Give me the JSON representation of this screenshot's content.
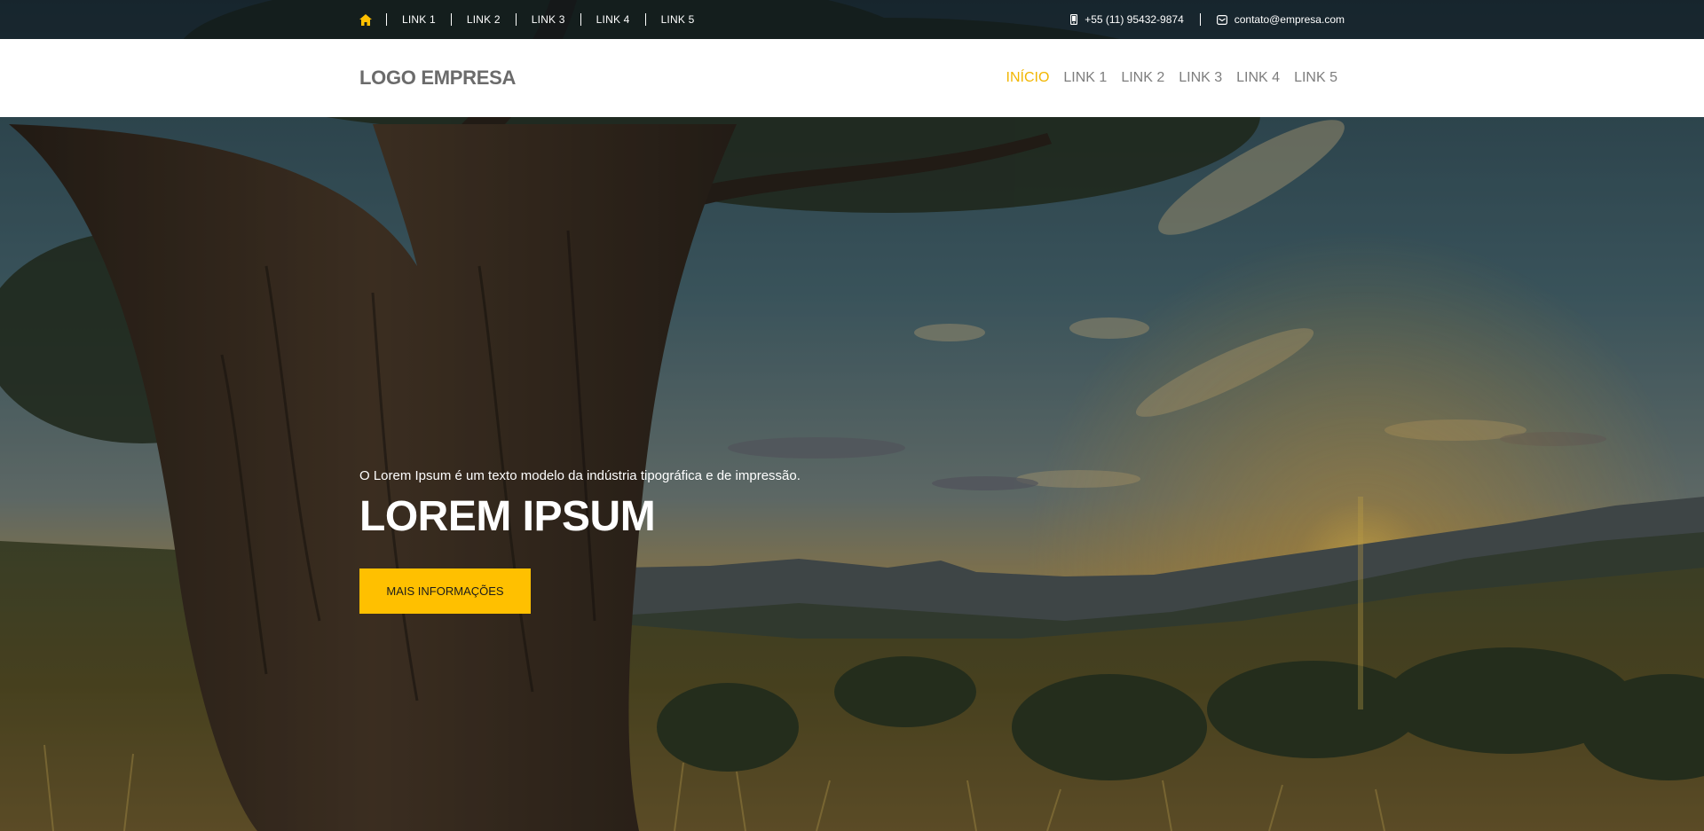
{
  "colors": {
    "accent": "#ffc000",
    "nav_active": "#f2b600",
    "nav_text": "#7d7d7d",
    "logo_text": "#6b6b6b",
    "topbar_text": "#ffffff"
  },
  "topbar": {
    "home_icon": "home-icon",
    "links": [
      "LINK 1",
      "LINK 2",
      "LINK 3",
      "LINK 4",
      "LINK 5"
    ],
    "phone_icon": "mobile-phone-icon",
    "phone": "+55 (11) 95432-9874",
    "email_icon": "envelope-icon",
    "email": "contato@empresa.com"
  },
  "navbar": {
    "logo": "LOGO EMPRESA",
    "items": [
      {
        "label": "INÍCIO",
        "active": true
      },
      {
        "label": "LINK 1",
        "active": false
      },
      {
        "label": "LINK 2",
        "active": false
      },
      {
        "label": "LINK 3",
        "active": false
      },
      {
        "label": "LINK 4",
        "active": false
      },
      {
        "label": "LINK 5",
        "active": false
      }
    ]
  },
  "hero": {
    "subtitle": "O Lorem Ipsum é um texto modelo da indústria tipográfica e de impressão.",
    "title": "LOREM IPSUM",
    "button": "MAIS INFORMAÇÕES"
  }
}
